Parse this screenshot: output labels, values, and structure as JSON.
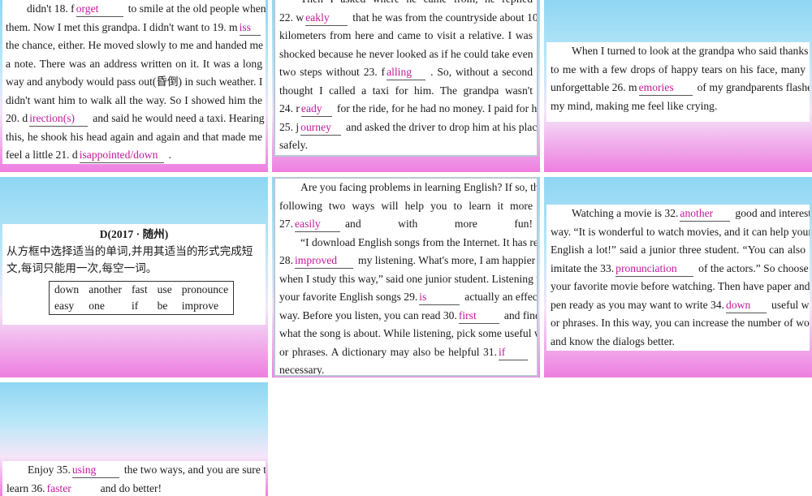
{
  "p1": {
    "lines": [
      {
        "a": "didn't 18. f",
        "ans": "orget",
        "b": "to smile at the old people whenever I saw"
      },
      {
        "a": "them. Now I met this grandpa. I didn't want to 19. m",
        "ans": "iss",
        "b": ""
      },
      {
        "a": "the chance, either.  He moved slowly to me and handed me"
      },
      {
        "a": "a note. There was an address written on it. It was a long"
      },
      {
        "a": "way and anybody would pass out(昏倒) in such weather. I"
      },
      {
        "a": "didn't want him to walk all the way. So I showed him the"
      },
      {
        "a": "20. d",
        "ans": "irection(s)",
        "b": "and said he would need a taxi.  Hearing"
      },
      {
        "a": "this, he shook his head again and again and that made me"
      },
      {
        "a": "feel a little 21. d",
        "ans": "isappointed/down",
        "b": "."
      }
    ]
  },
  "p2": {
    "lines": [
      {
        "a": "Then  I  asked  where  he  came  from,  he  replied"
      },
      {
        "a": "22. w",
        "ans": "eakly",
        "b": "that he was from the countryside about 10"
      },
      {
        "a": "kilometers from here and came to visit a relative. I was"
      },
      {
        "a": "shocked because he never looked as if he could take even"
      },
      {
        "a": "two  steps  without  23.  f",
        "ans": "alling",
        "b": ".  So, without  a  second"
      },
      {
        "a": "thought  I  called  a  taxi  for  him.  The  grandpa  wasn't"
      },
      {
        "a": "24. r",
        "ans": "eady",
        "b": "for the ride, for he had no money. I paid for his"
      },
      {
        "a": "25. j",
        "ans": "ourney",
        "b": "and asked the driver to drop him at his place"
      },
      {
        "a": "safely."
      }
    ]
  },
  "p3": {
    "lines": [
      {
        "a": "When I turned to look at the grandpa who said thanks"
      },
      {
        "a": "to me with a few drops of happy tears on his face, many"
      },
      {
        "a": "unforgettable 26. m",
        "ans": "emories",
        "b": "of my grandparents flashed in"
      },
      {
        "a": "my mind, making me feel like crying."
      }
    ]
  },
  "p4": {
    "title": "D(2017 · 随州)",
    "instr1": "从方框中选择适当的单词,并用其适当的形式完成短",
    "instr2": "文,每词只能用一次,每空一词。",
    "words": [
      [
        "down",
        "another",
        "fast",
        "use",
        "pronounce"
      ],
      [
        "easy",
        "one",
        "if",
        "be",
        "improve"
      ]
    ]
  },
  "p5": {
    "lines": [
      {
        "a": "Are you facing problems in learning English? If so, the"
      },
      {
        "a": "following  two  ways  will  help  you  to  learn  it  more"
      },
      {
        "a": "27.",
        "ans": "easily",
        "b": "and with more fun!"
      },
      {
        "a": "“I download English songs from the Internet. It has really"
      },
      {
        "a": "28.",
        "ans": "improved",
        "b": "my listening. What's more, I am happier"
      },
      {
        "a": "when I study this way,” said one junior student. Listening to"
      },
      {
        "a": "your favorite English songs 29.",
        "ans": "is",
        "b": "actually an effective"
      },
      {
        "a": "way. Before you listen, you can read 30.",
        "ans": "first",
        "b": "and find out"
      },
      {
        "a": "what the song is about. While listening, pick some useful words"
      },
      {
        "a": "or  phrases.  A  dictionary  may  also  be  helpful  31.",
        "ans": "if",
        "b": ""
      },
      {
        "a": "necessary."
      }
    ]
  },
  "p6": {
    "lines": [
      {
        "a": "Watching a movie is 32.",
        "ans": "another",
        "b": "good and interesting"
      },
      {
        "a": "way. “It is wonderful to watch movies, and it can help your"
      },
      {
        "a": "English a lot!” said a junior three student. “You can also"
      },
      {
        "a": "imitate the 33.",
        "ans": "pronunciation",
        "b": "of the actors.” So choose"
      },
      {
        "a": "your favorite movie before watching. Then have paper and a"
      },
      {
        "a": "pen ready as you may want to write 34.",
        "ans": "down",
        "b": "useful words"
      },
      {
        "a": "or phrases. In this way, you can increase the number of words"
      },
      {
        "a": "and know the dialogs better."
      }
    ]
  },
  "p7": {
    "lines": [
      {
        "a": "Enjoy 35.",
        "ans": "using",
        "b": "the two ways, and you are sure to"
      },
      {
        "a": "learn 36.",
        "ans": "faster",
        "b": "and do better!"
      }
    ]
  }
}
